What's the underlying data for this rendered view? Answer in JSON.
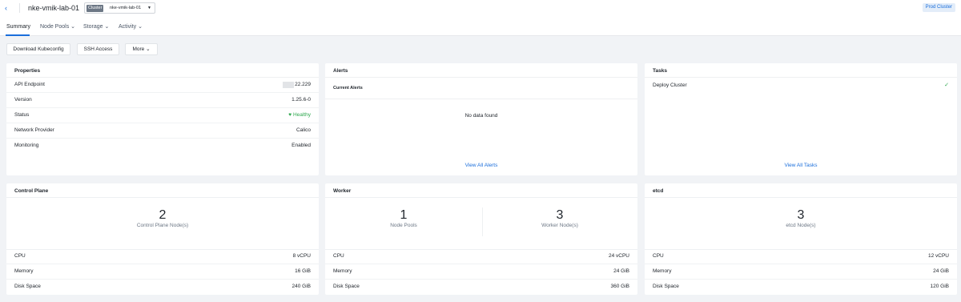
{
  "header": {
    "back_glyph": "‹",
    "title": "nke-vmik-lab-01",
    "cluster_tag": "Cluster",
    "cluster_value": "nke-vmik-lab-01",
    "badge": "Prod Cluster"
  },
  "tabs": [
    {
      "label": "Summary"
    },
    {
      "label": "Node Pools ⌄"
    },
    {
      "label": "Storage ⌄"
    },
    {
      "label": "Activity ⌄"
    }
  ],
  "actions": {
    "download": "Download Kubeconfig",
    "ssh": "SSH Access",
    "more": "More ⌄"
  },
  "properties": {
    "title": "Properties",
    "rows": [
      {
        "label": "API Endpoint",
        "value": "22.229"
      },
      {
        "label": "Version",
        "value": "1.25.6-0"
      },
      {
        "label": "Status",
        "value": "Healthy"
      },
      {
        "label": "Network Provider",
        "value": "Calico"
      },
      {
        "label": "Monitoring",
        "value": "Enabled"
      }
    ]
  },
  "alerts": {
    "title": "Alerts",
    "subtitle": "Current Alerts",
    "empty": "No data found",
    "link": "View All Alerts"
  },
  "tasks": {
    "title": "Tasks",
    "item": "Deploy Cluster",
    "check": "✓",
    "link": "View All Tasks"
  },
  "control_plane": {
    "title": "Control Plane",
    "count": "2",
    "count_label": "Control Plane Node(s)",
    "rows": [
      {
        "label": "CPU",
        "value": "8 vCPU"
      },
      {
        "label": "Memory",
        "value": "16 GiB"
      },
      {
        "label": "Disk Space",
        "value": "240 GiB"
      }
    ]
  },
  "worker": {
    "title": "Worker",
    "pools": "1",
    "pools_label": "Node Pools",
    "nodes": "3",
    "nodes_label": "Worker Node(s)",
    "rows": [
      {
        "label": "CPU",
        "value": "24 vCPU"
      },
      {
        "label": "Memory",
        "value": "24 GiB"
      },
      {
        "label": "Disk Space",
        "value": "360 GiB"
      }
    ]
  },
  "etcd": {
    "title": "etcd",
    "count": "3",
    "count_label": "etcd Node(s)",
    "rows": [
      {
        "label": "CPU",
        "value": "12 vCPU"
      },
      {
        "label": "Memory",
        "value": "24 GiB"
      },
      {
        "label": "Disk Space",
        "value": "120 GiB"
      }
    ]
  },
  "colors": {
    "accent": "#1a6edb",
    "healthy": "#2fa84f",
    "background": "#f1f3f6"
  }
}
